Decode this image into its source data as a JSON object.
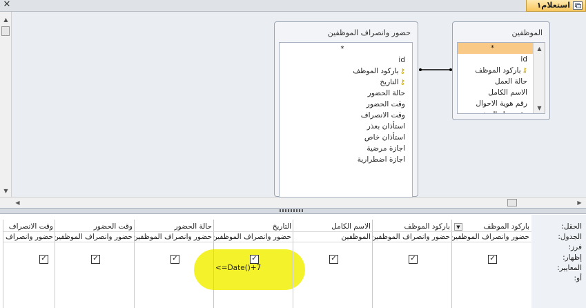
{
  "window": {
    "tab_title": "استعلام١",
    "close_symbol": "✕"
  },
  "tables": {
    "employees": {
      "title": "الموظفين",
      "fields": [
        "*",
        "id",
        "باركود الموظف",
        "حالة العمل",
        "الاسم الكامل",
        "رقم هوية الاحوال",
        "رقم جواز السفر"
      ],
      "selected_index": 0,
      "key_indices": [
        2
      ]
    },
    "attendance": {
      "title": "حضور وانصراف الموظفين",
      "fields": [
        "*",
        "id",
        "باركود الموظف",
        "التاريخ",
        "حالة الحضور",
        "وقت الحضور",
        "وقت الانصراف",
        "استأذان بعذر",
        "استأذان خاص",
        "اجازة مرضية",
        "اجازة اضطرارية"
      ],
      "key_indices": [
        2,
        3
      ]
    }
  },
  "grid": {
    "row_labels": [
      "الحقل:",
      "الجدول:",
      "فرز:",
      "إظهار:",
      "المعايير:",
      "أو:"
    ],
    "columns": [
      {
        "field": "باركود الموظف",
        "table": "حضور وانصراف الموظفين",
        "show": true,
        "criteria": "",
        "has_dropdown": true
      },
      {
        "field": "باركود الموظف",
        "table": "حضور وانصراف الموظفين",
        "show": true,
        "criteria": ""
      },
      {
        "field": "الاسم الكامل",
        "table": "الموظفين",
        "show": true,
        "criteria": ""
      },
      {
        "field": "التاريخ",
        "table": "حضور وانصراف الموظفين",
        "show": true,
        "criteria": "<=Date()+7"
      },
      {
        "field": "حالة الحضور",
        "table": "حضور وانصراف الموظفين",
        "show": true,
        "criteria": ""
      },
      {
        "field": "وقت الحضور",
        "table": "حضور وانصراف الموظفين",
        "show": true,
        "criteria": ""
      },
      {
        "field": "وقت الانصراف",
        "table": "حضور وانصراف",
        "show": true,
        "criteria": ""
      }
    ]
  },
  "colors": {
    "selected_field": "#f8c987",
    "highlight": "#f4f22a",
    "tab_accent": "#f7c65c"
  }
}
